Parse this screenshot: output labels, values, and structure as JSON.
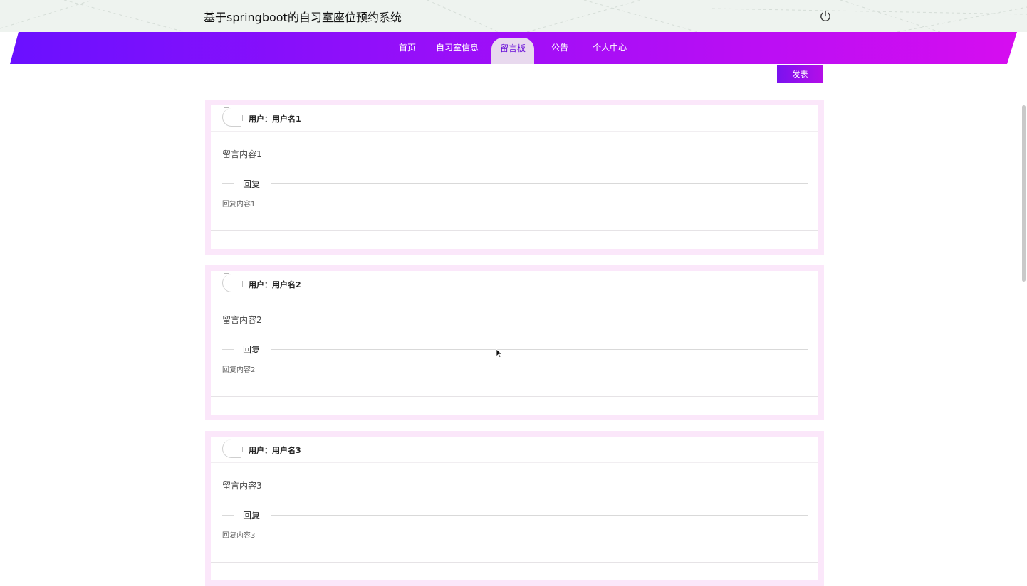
{
  "header": {
    "title": "基于springboot的自习室座位预约系统",
    "logout_icon": "power-icon"
  },
  "nav": {
    "items": [
      {
        "label": "首页",
        "active": false
      },
      {
        "label": "自习室信息",
        "active": false
      },
      {
        "label": "留言板",
        "active": true
      },
      {
        "label": "公告",
        "active": false
      },
      {
        "label": "个人中心",
        "active": false
      }
    ],
    "gradient_colors": [
      "#6a10ff",
      "#d60df0"
    ]
  },
  "actions": {
    "publish_label": "发表"
  },
  "messages": [
    {
      "user": "用户：用户名1",
      "content": "留言内容1",
      "reply_label": "回复",
      "reply": "回复内容1"
    },
    {
      "user": "用户：用户名2",
      "content": "留言内容2",
      "reply_label": "回复",
      "reply": "回复内容2"
    },
    {
      "user": "用户：用户名3",
      "content": "留言内容3",
      "reply_label": "回复",
      "reply": "回复内容3"
    }
  ],
  "colors": {
    "accent": "#7a12ef",
    "card_border": "#fbe7fa",
    "active_tab_bg": "#e8d9ee"
  }
}
